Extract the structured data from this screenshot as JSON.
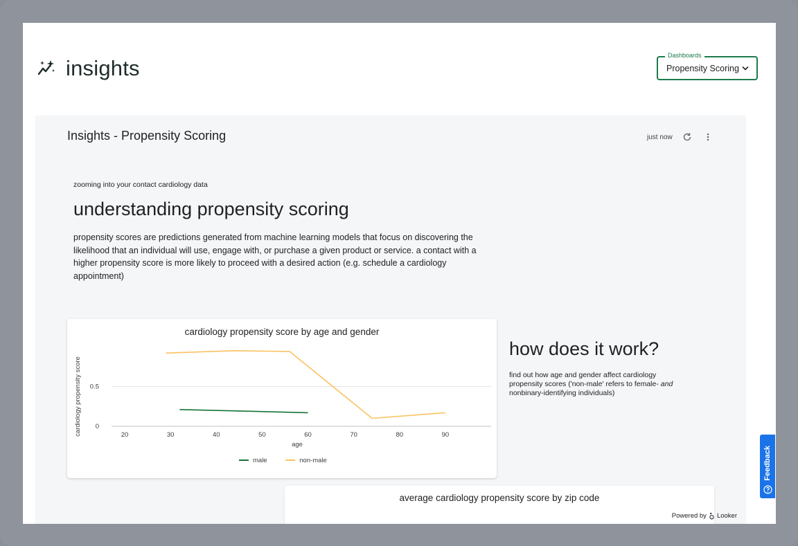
{
  "brand": {
    "title": "insights",
    "icon": "sparkle-insights-icon"
  },
  "dashboard_select": {
    "legend": "Dashboards",
    "value": "Propensity Scoring"
  },
  "panel": {
    "title": "Insights - Propensity Scoring",
    "updated": "just now",
    "refresh_icon": "refresh-icon",
    "menu_icon": "more-vert-icon"
  },
  "intro": {
    "kicker": "zooming into your contact cardiology data",
    "heading": "understanding propensity scoring",
    "body": "propensity scores are predictions generated from machine learning models that focus on discovering the likelihood that an individual will use, engage with, or purchase a given product or service. a contact with a higher propensity score is more likely to proceed with a desired action (e.g. schedule a cardiology appointment)"
  },
  "how": {
    "heading": "how does it work?",
    "body_pre": "find out how age and gender affect cardiology propensity scores ('non-male' refers to female- ",
    "body_em": "and",
    "body_post": " nonbinary-identifying individuals)"
  },
  "second_card": {
    "title": "average cardiology propensity score by zip code"
  },
  "footer": {
    "powered_by": "Powered by",
    "brand": "Looker"
  },
  "feedback": {
    "label": "Feedback"
  },
  "colors": {
    "male": "#137333",
    "non_male": "#fbc160",
    "accent": "#1e7a4c",
    "feedback": "#1a73e8"
  },
  "chart_data": {
    "type": "line",
    "title": "cardiology propensity score by age and gender",
    "xlabel": "age",
    "ylabel": "cardiology propensity score",
    "xlim": [
      15,
      100
    ],
    "ylim": [
      0,
      1.0
    ],
    "x_ticks": [
      20,
      30,
      40,
      50,
      60,
      70,
      80,
      90
    ],
    "y_ticks": [
      0,
      0.5
    ],
    "grid": true,
    "legend": "bottom",
    "series": [
      {
        "name": "male",
        "color": "#137333",
        "points": [
          [
            32,
            0.21
          ],
          [
            60,
            0.17
          ]
        ]
      },
      {
        "name": "non-male",
        "color": "#fbc160",
        "points": [
          [
            29,
            0.92
          ],
          [
            44,
            0.95
          ],
          [
            56,
            0.94
          ],
          [
            74,
            0.1
          ],
          [
            90,
            0.17
          ]
        ]
      }
    ]
  }
}
